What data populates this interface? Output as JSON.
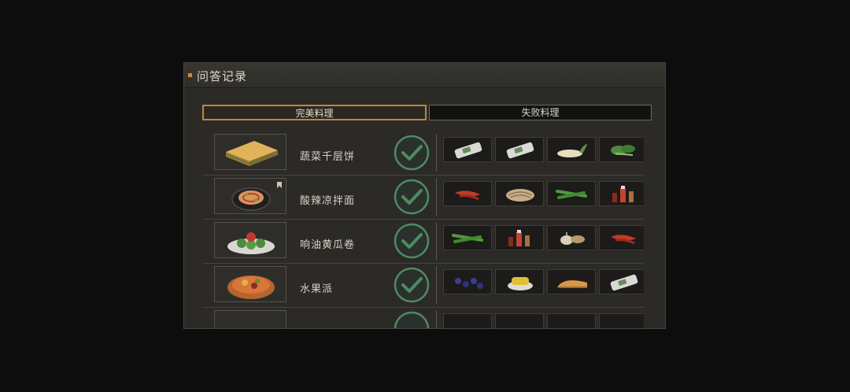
{
  "panel": {
    "title": "问答记录"
  },
  "tabs": [
    {
      "label": "完美料理",
      "active": true
    },
    {
      "label": "失败料理",
      "active": false
    }
  ],
  "colors": {
    "accent": "#d5872f",
    "check": "#4e8a62",
    "panel_bg": "#2b2a27"
  },
  "dishes": [
    {
      "name": "蔬菜千层饼",
      "icon": "layered-pancake-icon",
      "completed": true,
      "ingredients": [
        "flour-bag-icon",
        "flour-bag-icon",
        "radish-icon",
        "greens-icon"
      ]
    },
    {
      "name": "酸辣凉拌面",
      "icon": "cold-noodles-icon",
      "completed": true,
      "badge": "bookmark-icon",
      "ingredients": [
        "chili-pepper-icon",
        "noodles-bundle-icon",
        "green-beans-icon",
        "sauce-bottles-icon"
      ]
    },
    {
      "name": "响油黄瓜卷",
      "icon": "cucumber-rolls-icon",
      "completed": true,
      "ingredients": [
        "green-beans-icon",
        "sauce-bottles-icon",
        "garlic-ginger-icon",
        "chili-pepper-icon"
      ]
    },
    {
      "name": "水果派",
      "icon": "fruit-pie-icon",
      "completed": true,
      "ingredients": [
        "blueberries-icon",
        "corn-icon",
        "bread-icon",
        "flour-bag-icon"
      ]
    }
  ]
}
